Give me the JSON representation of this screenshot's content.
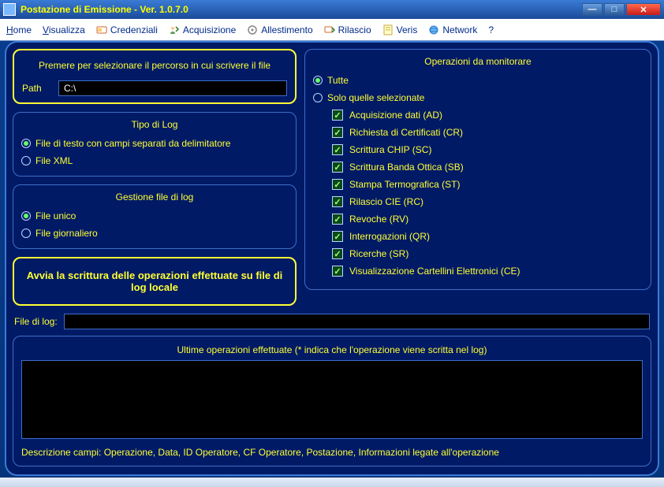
{
  "window": {
    "title": "Postazione di Emissione - Ver. 1.0.7.0"
  },
  "menu": {
    "home": "Home",
    "visualizza": "Visualizza",
    "credenziali": "Credenziali",
    "acquisizione": "Acquisizione",
    "allestimento": "Allestimento",
    "rilascio": "Rilascio",
    "veris": "Veris",
    "network": "Network",
    "help": "?"
  },
  "pathpanel": {
    "button": "Premere per selezionare il percorso in cui scrivere il file",
    "path_label": "Path",
    "path_value": "C:\\"
  },
  "logtype": {
    "title": "Tipo di Log",
    "delimited": "File di testo con campi separati da delimitatore",
    "xml": "File XML",
    "selected": "delimited"
  },
  "logmgmt": {
    "title": "Gestione file di log",
    "single": "File unico",
    "daily": "File giornaliero",
    "selected": "single"
  },
  "start_btn": "Avvia la scrittura delle operazioni effettuate su file di log locale",
  "monitor": {
    "title": "Operazioni da monitorare",
    "all": "Tutte",
    "selected_label": "Solo quelle selezionate",
    "mode": "all",
    "items": [
      "Acquisizione dati (AD)",
      "Richiesta di Certificati (CR)",
      "Scrittura CHIP (SC)",
      "Scrittura Banda Ottica (SB)",
      "Stampa Termografica (ST)",
      "Rilascio CIE (RC)",
      "Revoche (RV)",
      "Interrogazioni (QR)",
      "Ricerche (SR)",
      "Visualizzazione Cartellini Elettronici (CE)"
    ]
  },
  "filelog": {
    "label": "File di log:",
    "value": ""
  },
  "lastops": {
    "title": "Ultime operazioni effettuate (* indica che l'operazione viene scritta nel log)",
    "descr": "Descrizione campi: Operazione, Data, ID Operatore, CF Operatore, Postazione, Informazioni legate all'operazione"
  }
}
